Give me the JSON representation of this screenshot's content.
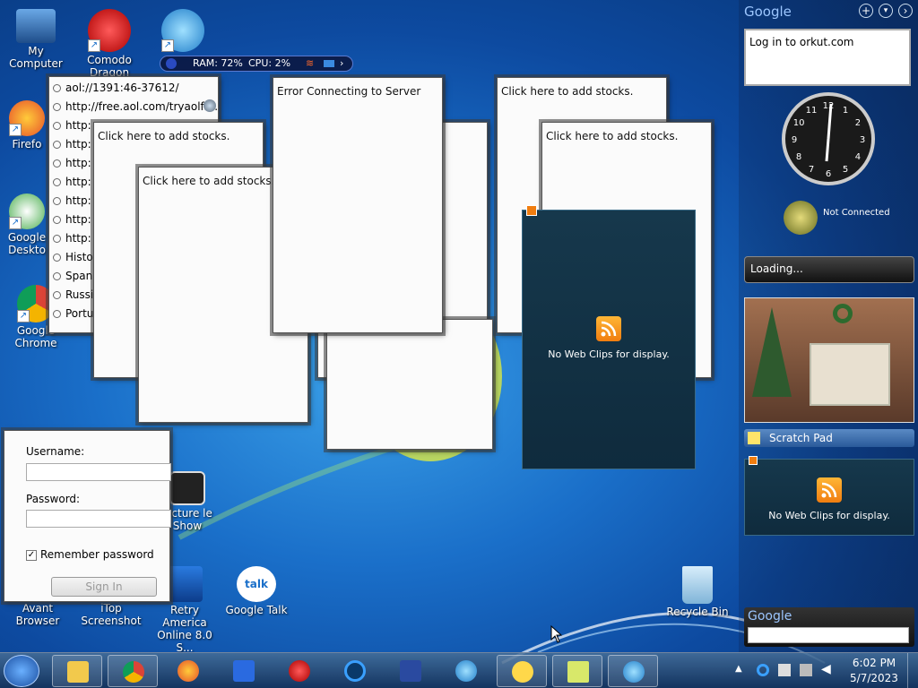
{
  "desktop_icons": {
    "my_computer": "My Computer",
    "comodo": "Comodo Dragon",
    "firefox": "Firefo",
    "google_desktop": "Google Deskto",
    "chrome": "Google Chrome",
    "picture_slideshow": "Picture le Show",
    "avant": "Avant Browser",
    "itop": "iTop Screenshot",
    "retry_aol": "Retry America Online 8.0 S...",
    "google_talk": "Google Talk",
    "recycle_bin": "Recycle Bin"
  },
  "monitor": {
    "ram": "RAM: 72%",
    "cpu": "CPU: 2%"
  },
  "history": {
    "items": [
      "aol://1391:46-37612/",
      "http://free.aol.com/tryaolfr...",
      "http:",
      "http:",
      "http:",
      "http:",
      "http:",
      "http:",
      "http:",
      "Histo",
      "Spani",
      "Russia",
      "Portu"
    ]
  },
  "stocks": {
    "label_1": "Click here to add stocks.",
    "label_2": "Click here to add stocks.",
    "label_3": "Click here to add stocks.",
    "label_4": "Click here to add stocks."
  },
  "error_gadget": {
    "text": "Error Connecting to Server"
  },
  "web_clips": {
    "text": "No Web Clips for display.",
    "side_text": "No Web Clips for display."
  },
  "login": {
    "username_label": "Username:",
    "password_label": "Password:",
    "remember_label": "Remember password",
    "signin_label": "Sign In"
  },
  "sidebar": {
    "brand": "Google",
    "orkut_text": "Log in to orkut.com",
    "clock_numbers": [
      "12",
      "1",
      "2",
      "3",
      "4",
      "5",
      "6",
      "7",
      "8",
      "9",
      "10",
      "11"
    ],
    "not_connected": "Not Connected",
    "loading": "Loading...",
    "scratch_pad": "Scratch Pad",
    "search_brand": "Google"
  },
  "taskbar": {
    "time": "6:02 PM",
    "date": "5/7/2023"
  },
  "colors": {
    "accent": "#1a6fc9",
    "clip_bg": "#16384c",
    "rss": "#f07d10"
  }
}
